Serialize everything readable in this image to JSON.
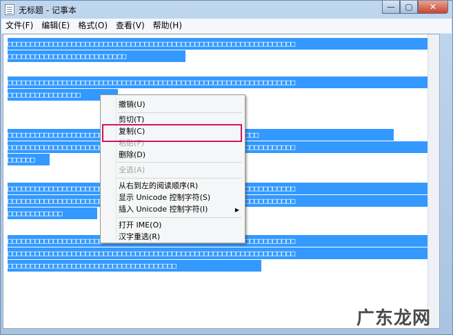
{
  "window": {
    "title": "无标题 - 记事本",
    "buttons": [
      "—",
      "▢",
      "✕"
    ]
  },
  "menu": [
    "文件(F)",
    "编辑(E)",
    "格式(O)",
    "查看(V)",
    "帮助(H)"
  ],
  "text_lines": [
    "□□□□□□□□□□□□□□□□□□□□□□□□□□□□□□□□□□□□□□□□□□□□□□□□□□□□□□□□□□□□□□□",
    "□□□□□□□□□□□□□□□□□□□□□□□□□□",
    "□□□□□□□□□□□□□□□□□□□□□□□□□□□□□□□□□□□□□□□□□□□□□□□□□□□□□□□□□□□□□□□",
    "□□□□□□□□□□□□□□□□",
    "□□□□□□□□□□□□□□□□□□□□□□□□□□□□□□□□□□□□□□□□□□□□□□□□□□□□□□□",
    "□□□□□□□□□□□□□□□□□□□□□□□□□□□□□□□□□□□□□□□□□□□□□□□□□□□□□□□□□□□□□□□",
    "□□□□□□",
    "□□□□□□□□□□□□□□□□□□□□□□□□□□□□□□□□□□□□□□□□□□□□□□□□□□□□□□□□□□□□□□□",
    "□□□□□□□□□□□□□□□□□□□□□□□□□□□□□□□□□□□□□□□□□□□□□□□□□□□□□□□□□□□□□□□",
    "□□□□□□□□□□□□",
    "□□□□□□□□□□□□□□□□□□□□□□□□□□□□□□□□□□□□□□□□□□□□□□□□□□□□□□□□□□□□□□□",
    "□□□□□□□□□□□□□□□□□□□□□□□□□□□□□□□□□□□□□□□□□□□□□□□□□□□□□□□□□□□□□□□",
    "□□□□□□□□□□□□□□□□□□□□□□□□□□□□□□□□□□□□□"
  ],
  "context_menu": {
    "items": [
      {
        "label": "撤销(U)",
        "enabled": true
      },
      {
        "label": "剪切(T)",
        "enabled": true
      },
      {
        "label": "复制(C)",
        "enabled": true
      },
      {
        "label": "粘贴(P)",
        "enabled": false
      },
      {
        "label": "删除(D)",
        "enabled": true
      },
      {
        "label": "全选(A)",
        "enabled": false
      },
      {
        "label": "从右到左的阅读顺序(R)",
        "enabled": true
      },
      {
        "label": "显示 Unicode 控制字符(S)",
        "enabled": true
      },
      {
        "label": "插入 Unicode 控制字符(I)",
        "enabled": true
      },
      {
        "label": "打开 IME(O)",
        "enabled": true
      },
      {
        "label": "汉字重选(R)",
        "enabled": true
      }
    ],
    "submenu_arrow": "▶"
  },
  "watermark": "广东龙网",
  "colors": {
    "selection": "#3399ff",
    "highlight_box": "#d0125e"
  }
}
